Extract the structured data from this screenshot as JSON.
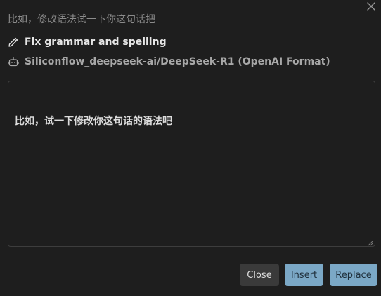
{
  "prompt": {
    "text": "比如，修改语法试一下你这句话把"
  },
  "action": {
    "icon": "pencil-icon",
    "label": "Fix grammar and spelling"
  },
  "model": {
    "icon": "bot-icon",
    "label": "Siliconflow_deepseek-ai/DeepSeek-R1 (OpenAI Format)"
  },
  "result": {
    "text": "比如，试一下修改你这句话的语法吧"
  },
  "buttons": {
    "close": "Close",
    "insert": "Insert",
    "replace": "Replace"
  },
  "colors": {
    "background": "#1e1e1e",
    "accent": "#7ba8c6",
    "secondary_button": "#3a3a3a"
  }
}
